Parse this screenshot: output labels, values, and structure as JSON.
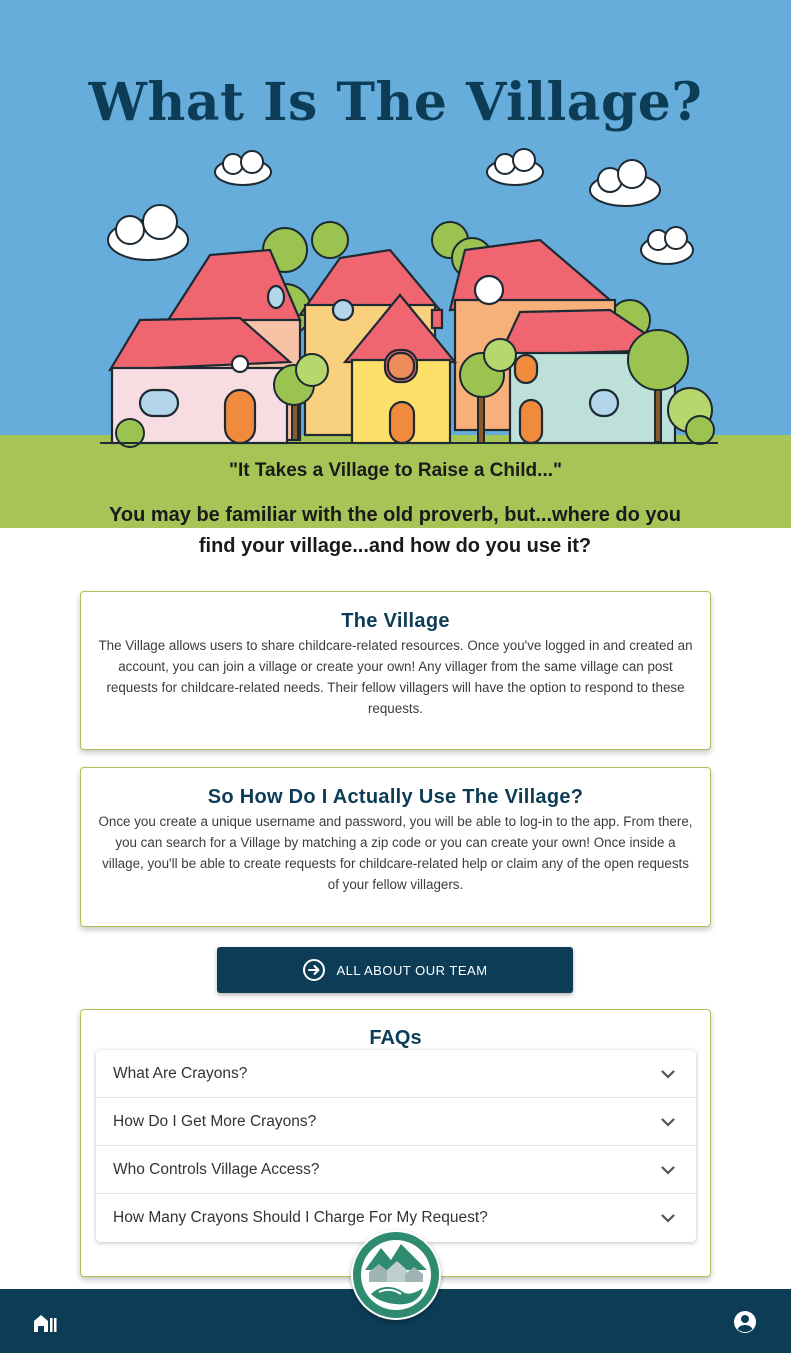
{
  "hero": {
    "title": "What Is The Village?",
    "proverb": "\"It Takes a Village to Raise a Child...\"",
    "intro": "You may be familiar with the old proverb, but...where do you find your village...and how do you use it?"
  },
  "about_card": {
    "title": "The Village",
    "body": "The Village allows users to share childcare-related resources. Once you've logged in and created an account, you can join a village or create your own! Any villager from the same village can post requests for childcare-related needs. Their fellow villagers will have the option to respond to these requests."
  },
  "howto_card": {
    "title": "So How Do I Actually Use The Village?",
    "body": "Once you create a unique username and password, you will be able to log-in to the app. From there, you can search for a Village by matching a zip code or you can create your own! Once inside a village, you'll be able to create requests for childcare-related help or claim any of the open requests of your fellow villagers."
  },
  "team_button": {
    "label": "ALL ABOUT OUR TEAM",
    "icon": "arrow-circle-right-icon"
  },
  "faq": {
    "title": "FAQs",
    "items": [
      {
        "question": "What Are Crayons?"
      },
      {
        "question": "How Do I Get More Crayons?"
      },
      {
        "question": "Who Controls Village Access?"
      },
      {
        "question": "How Many Crayons Should I Charge For My Request?"
      }
    ]
  },
  "nav": {
    "home_icon": "village-home-icon",
    "profile_icon": "account-circle-icon",
    "logo": "village-logo"
  },
  "colors": {
    "navy": "#0d3d56",
    "sky": "#66addc",
    "grass": "#a7c557",
    "roof": "#ef6670",
    "logo_green": "#2e8b6f"
  }
}
